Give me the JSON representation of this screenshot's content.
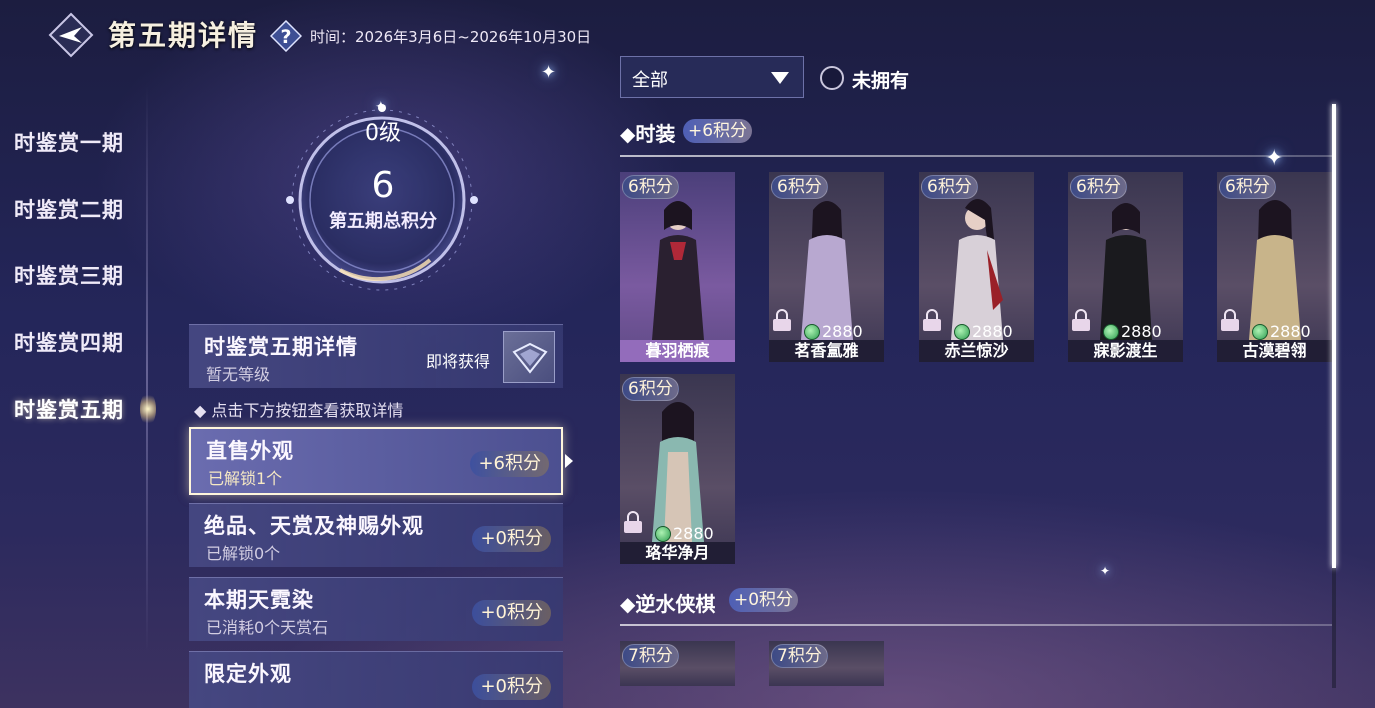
{
  "header": {
    "title": "第五期详情",
    "time_text": "时间：2026年3月6日~2026年10月30日"
  },
  "nav": {
    "items": [
      "时鉴赏一期",
      "时鉴赏二期",
      "时鉴赏三期",
      "时鉴赏四期",
      "时鉴赏五期"
    ],
    "active_index": 4
  },
  "level": {
    "level_text": "0级",
    "total_points": "6",
    "total_points_label": "第五期总积分"
  },
  "details_panel": {
    "title": "时鉴赏五期详情",
    "subtitle": "暂无等级",
    "coming_label": "即将获得"
  },
  "hint": "点击下方按钮查看获取详情",
  "categories": [
    {
      "title": "直售外观",
      "status": "已解锁1个",
      "points": "+6积分",
      "selected": true
    },
    {
      "title": "绝品、天赏及神赐外观",
      "status": "已解锁0个",
      "points": "+0积分"
    },
    {
      "title": "本期天霓染",
      "status": "已消耗0个天赏石",
      "points": "+0积分"
    },
    {
      "title": "限定外观",
      "status": "",
      "points": "+0积分"
    }
  ],
  "filter": {
    "selected": "全部",
    "unowned_label": "未拥有",
    "unowned_checked": false
  },
  "sections": [
    {
      "title": "时装",
      "points": "+6积分",
      "items": [
        {
          "name": "暮羽栖痕",
          "points": "6积分",
          "owned": true,
          "price": ""
        },
        {
          "name": "茗香氲雅",
          "points": "6积分",
          "owned": false,
          "price": "2880"
        },
        {
          "name": "赤兰惊沙",
          "points": "6积分",
          "owned": false,
          "price": "2880"
        },
        {
          "name": "寐影渡生",
          "points": "6积分",
          "owned": false,
          "price": "2880"
        },
        {
          "name": "古漠碧翎",
          "points": "6积分",
          "owned": false,
          "price": "2880"
        },
        {
          "name": "珞华净月",
          "points": "6积分",
          "owned": false,
          "price": "2880"
        }
      ]
    },
    {
      "title": "逆水侠棋",
      "points": "+0积分",
      "items": [
        {
          "points": "7积分"
        },
        {
          "points": "7积分"
        }
      ]
    }
  ],
  "scroll": {
    "visible_fraction": 0.8
  },
  "colors": {
    "accent_gold": "#f6e9c4",
    "currency_green": "#2e9e50",
    "background": "#24265a"
  }
}
